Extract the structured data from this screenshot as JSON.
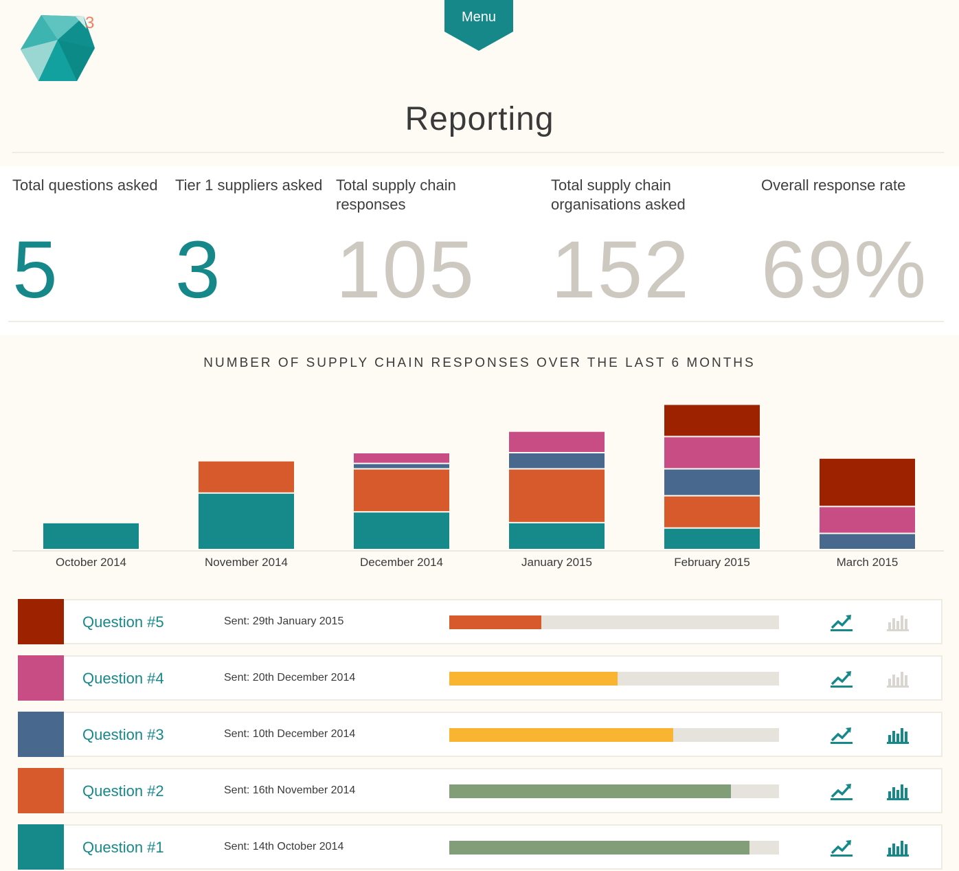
{
  "app": {
    "logo_superscript": "3",
    "menu_label": "Menu",
    "page_title": "Reporting"
  },
  "stats": [
    {
      "label": "Total questions asked",
      "value": "5",
      "color": "#17888a"
    },
    {
      "label": "Tier 1 suppliers asked",
      "value": "3",
      "color": "#17888a"
    },
    {
      "label": "Total supply chain responses",
      "value": "105",
      "color": "#cdc8c0"
    },
    {
      "label": "Total supply chain organisations asked",
      "value": "152",
      "color": "#cdc8c0"
    },
    {
      "label": "Overall response rate",
      "value": "69%",
      "color": "#cdc8c0"
    }
  ],
  "colors": {
    "q1": "#168a8b",
    "q2": "#d65a2b",
    "q3": "#48698d",
    "q4": "#c84d85",
    "q5": "#9c2200",
    "teal": "#17888a",
    "bar_track": "#e6e3dd"
  },
  "chart_data": {
    "type": "bar",
    "stacked": true,
    "title": "NUMBER OF SUPPLY CHAIN RESPONSES OVER THE LAST 6 MONTHS",
    "categories": [
      "October 2014",
      "November 2014",
      "December 2014",
      "January 2015",
      "February 2015",
      "March 2015"
    ],
    "series": [
      {
        "name": "Question #1",
        "color": "#168a8b",
        "values": [
          10,
          21,
          14,
          10,
          8,
          0
        ]
      },
      {
        "name": "Question #2",
        "color": "#d65a2b",
        "values": [
          0,
          12,
          16,
          20,
          12,
          0
        ]
      },
      {
        "name": "Question #3",
        "color": "#48698d",
        "values": [
          0,
          0,
          2,
          6,
          10,
          6
        ]
      },
      {
        "name": "Question #4",
        "color": "#c84d85",
        "values": [
          0,
          0,
          4,
          8,
          12,
          10
        ]
      },
      {
        "name": "Question #5",
        "color": "#9c2200",
        "values": [
          0,
          0,
          0,
          0,
          12,
          18
        ]
      }
    ],
    "ylim": [
      0,
      60
    ],
    "xlabel": "",
    "ylabel": "",
    "grid": false,
    "legend": "none"
  },
  "questions": [
    {
      "name": "Question #5",
      "sent": "Sent: 29th January 2015",
      "color": "#9c2200",
      "progress": 0.28,
      "bar_color": "#d65a2b",
      "trend_icon": "trend-up-icon",
      "bar_icon": "bar-chart-icon",
      "bar_icon_active": false
    },
    {
      "name": "Question #4",
      "sent": "Sent: 20th December 2014",
      "color": "#c84d85",
      "progress": 0.51,
      "bar_color": "#f9b531",
      "trend_icon": "trend-up-icon",
      "bar_icon": "bar-chart-icon",
      "bar_icon_active": false
    },
    {
      "name": "Question #3",
      "sent": "Sent: 10th December 2014",
      "color": "#48698d",
      "progress": 0.68,
      "bar_color": "#f9b531",
      "trend_icon": "trend-up-icon",
      "bar_icon": "bar-chart-icon",
      "bar_icon_active": true
    },
    {
      "name": "Question #2",
      "sent": "Sent: 16th November 2014",
      "color": "#d65a2b",
      "progress": 0.855,
      "bar_color": "#829e79",
      "trend_icon": "trend-up-icon",
      "bar_icon": "bar-chart-icon",
      "bar_icon_active": true
    },
    {
      "name": "Question #1",
      "sent": "Sent: 14th October 2014",
      "color": "#168a8b",
      "progress": 0.91,
      "bar_color": "#829e79",
      "trend_icon": "trend-up-icon",
      "bar_icon": "bar-chart-icon",
      "bar_icon_active": true
    }
  ]
}
